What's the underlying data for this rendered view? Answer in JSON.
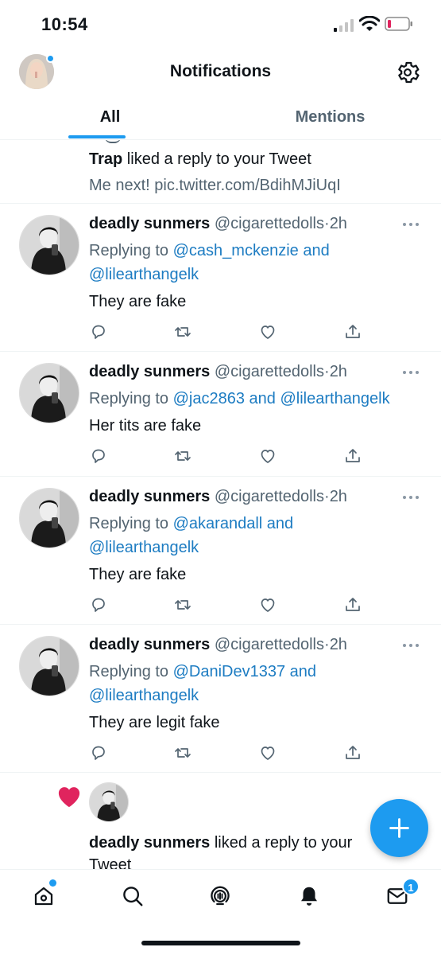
{
  "status_bar": {
    "time": "10:54"
  },
  "header": {
    "title": "Notifications"
  },
  "tabs": [
    {
      "label": "All"
    },
    {
      "label": "Mentions"
    }
  ],
  "top_notification": {
    "actor": "Trap",
    "action": " liked a reply to your Tweet",
    "preview": "Me next! pic.twitter.com/BdihMJiUqI"
  },
  "tweets": [
    {
      "name": "deadly sunmers",
      "handle": "@cigarettedolls",
      "separator": "·",
      "time": "2h",
      "replying_prefix": "Replying to ",
      "replying_line1": "@cash_mckenzie and",
      "replying_line2": "@lilearthangelk",
      "text": "They are fake"
    },
    {
      "name": "deadly sunmers",
      "handle": "@cigarettedolls",
      "separator": "·",
      "time": "2h",
      "replying_prefix": "Replying to ",
      "replying_line1": "@jac2863 and @lilearthangelk",
      "replying_line2": "",
      "text": "Her tits are fake"
    },
    {
      "name": "deadly sunmers",
      "handle": "@cigarettedolls",
      "separator": "·",
      "time": "2h",
      "replying_prefix": "Replying to ",
      "replying_line1": "@akarandall and",
      "replying_line2": "@lilearthangelk",
      "text": "They are fake"
    },
    {
      "name": "deadly sunmers",
      "handle": "@cigarettedolls",
      "separator": "·",
      "time": "2h",
      "replying_prefix": "Replying to ",
      "replying_line1": "@DaniDev1337 and",
      "replying_line2": "@lilearthangelk",
      "text": "They are legit fake"
    }
  ],
  "like_notification": {
    "actor": "deadly sunmers",
    "action": " liked a reply to your Tweet"
  },
  "nav": {
    "messages_badge": "1"
  },
  "icons": {
    "settings": "gear-icon",
    "reply": "reply-icon",
    "retweet": "retweet-icon",
    "like": "heart-icon",
    "share": "share-icon",
    "compose": "plus-icon",
    "home": "home-icon",
    "search": "search-icon",
    "spaces": "spaces-icon",
    "notifications": "bell-icon",
    "messages": "envelope-icon"
  },
  "colors": {
    "accent": "#1d9bf0",
    "mention": "#1d7cc2",
    "like_heart": "#e0245e",
    "secondary_text": "#536471"
  }
}
